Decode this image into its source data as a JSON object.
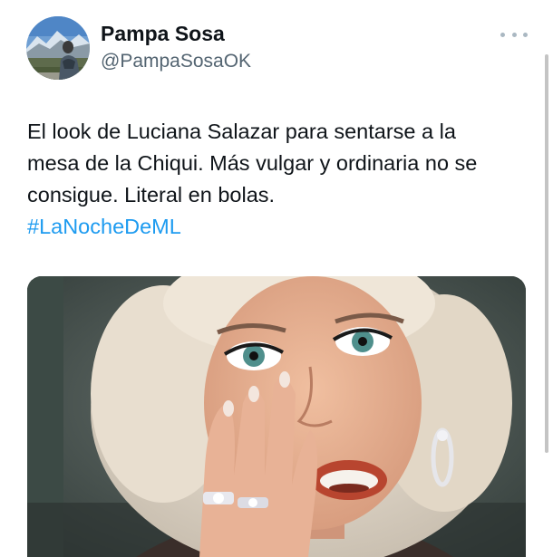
{
  "author": {
    "display_name": "Pampa Sosa",
    "handle": "@PampaSosaOK",
    "avatar_icon": "profile-photo-mountains"
  },
  "menu": {
    "icon": "more-horizontal-icon"
  },
  "tweet": {
    "lines": [
      "El look de Luciana Salazar para sentarse a la",
      "mesa de la Chiqui. Más vulgar y ordinaria no se",
      "consigue. Literal en bolas."
    ],
    "hashtag": "#LaNocheDeML"
  },
  "media": {
    "icon": "photo-shocked-woman-hand-on-face"
  },
  "colors": {
    "text": "#0f1419",
    "secondary": "#536471",
    "link": "#1d9bf0",
    "more_dots": "#aab8c2"
  }
}
